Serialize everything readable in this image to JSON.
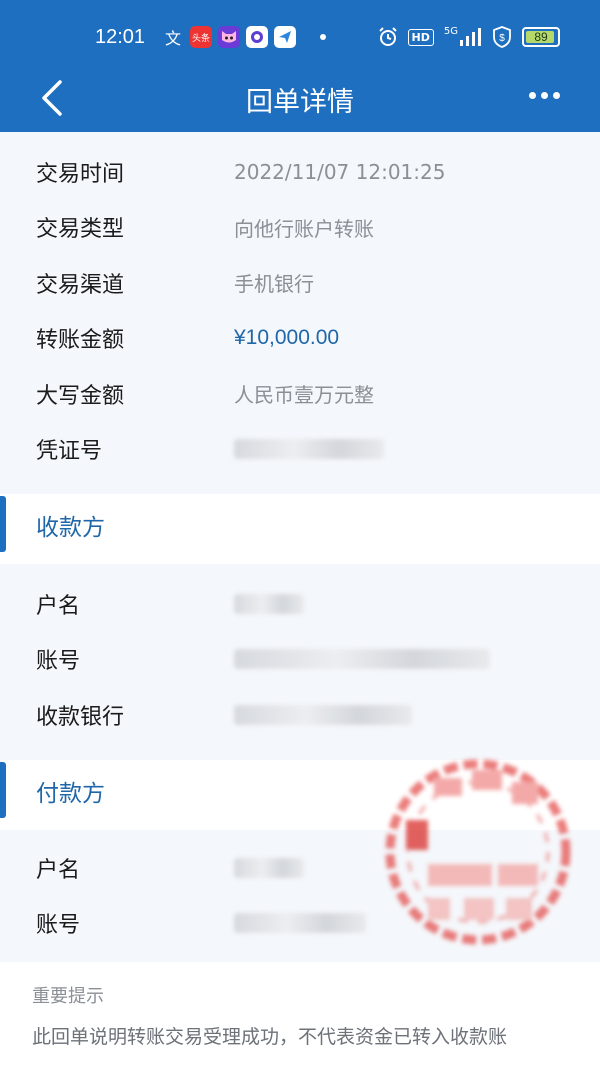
{
  "status_bar": {
    "time": "12:01",
    "app_icons": [
      "wenku-icon",
      "toutiao-icon",
      "cat-icon",
      "app-icon",
      "send-icon"
    ],
    "toutiao_label": "头条",
    "network": "5G",
    "hd_label": "HD",
    "battery": "89"
  },
  "nav": {
    "title": "回单详情"
  },
  "transaction": [
    {
      "label": "交易时间",
      "value": "2022/11/07  12:01:25"
    },
    {
      "label": "交易类型",
      "value": "向他行账户转账"
    },
    {
      "label": "交易渠道",
      "value": "手机银行"
    },
    {
      "label": "转账金额",
      "value": "¥10,000.00"
    },
    {
      "label": "大写金额",
      "value": "人民币壹万元整"
    },
    {
      "label": "凭证号",
      "value": ""
    }
  ],
  "payee": {
    "section_title": "收款方",
    "rows": [
      {
        "label": "户名"
      },
      {
        "label": "账号"
      },
      {
        "label": "收款银行"
      }
    ]
  },
  "payer": {
    "section_title": "付款方",
    "rows": [
      {
        "label": "户名"
      },
      {
        "label": "账号"
      }
    ]
  },
  "notice": {
    "title": "重要提示",
    "text": "此回单说明转账交易受理成功，不代表资金已转入收款账"
  },
  "colors": {
    "brand": "#1f6fc0",
    "amount": "#1f67a8",
    "seal": "#e4514f"
  }
}
